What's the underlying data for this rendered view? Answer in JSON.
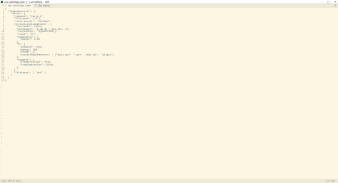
{
  "window": {
    "title": "coc-settings.json (~\\.vim\\files) - VIM"
  },
  "tabs": [
    {
      "label": "1 + coc-settings.json"
    },
    {
      "label": "2 [No Name]"
    }
  ],
  "tabline_right": "X",
  "code_lines": [
    {
      "n": "1",
      "text": "{"
    },
    {
      "n": "2",
      "text": "  \"languageserver\": {"
    },
    {
      "n": "3",
      "text": "    \"dlang\": {"
    },
    {
      "n": "4",
      "text": "      \"command\": \"serve-d\","
    },
    {
      "n": "5",
      "text": "      \"filetypes\": [\"d\"],"
    },
    {
      "n": "6",
      "text": "      \"trace.server\": \"verbose\","
    },
    {
      "n": "7",
      "text": "      \"initializationOptions\": {"
    },
    {
      "n": "8",
      "text": "        \"nullable\": false,"
    },
    {
      "n": "9",
      "text": "        \"workspace\": \"8,46-55,~,181-253,~,4\","
    },
    {
      "n": "10",
      "text": "        \"stdlibPath\": \"${DIRECTORY}\","
    },
    {
      "n": "11",
      "text": "        \"trace\": \"$*\","
    },
    {
      "n": "12",
      "text": "        \"diagnostic\": {"
    },
    {
      "n": "13",
      "text": "          \"enable\": true"
    },
    {
      "n": "14",
      "text": "        },"
    },
    {
      "n": "15",
      "text": "        \"d\": {"
    },
    {
      "n": "16",
      "text": "          \"enabled\": true,"
    },
    {
      "n": "17",
      "text": "          \"debug\": 100,"
    },
    {
      "n": "18",
      "text": "          \"chunk\": 0,"
    },
    {
      "n": "19",
      "text": "          \"projectRootPatterns\" : [\"dub.json\", \".git\", \"dub.sdl\", \"plugin\"]"
    },
    {
      "n": "20",
      "text": "        },"
    },
    {
      "n": "21",
      "text": "        \"suggest\": {"
    },
    {
      "n": "22",
      "text": "          \"fromSelection\": true,"
    },
    {
      "n": "23",
      "text": "          \"fromCompletion\": false"
    },
    {
      "n": "24",
      "text": "        }"
    },
    {
      "n": "25",
      "text": "      },"
    },
    {
      "n": "26",
      "text": "      \"filetypes\": [ \"dub\" ]"
    },
    {
      "n": "27",
      "text": "    }"
    },
    {
      "n": "28",
      "text": "  }"
    },
    {
      "n": "29",
      "text": "}"
    }
  ],
  "eob_marker": "~",
  "statusline": {
    "left": "json utf-8 unix",
    "right": "1:1 Top"
  }
}
